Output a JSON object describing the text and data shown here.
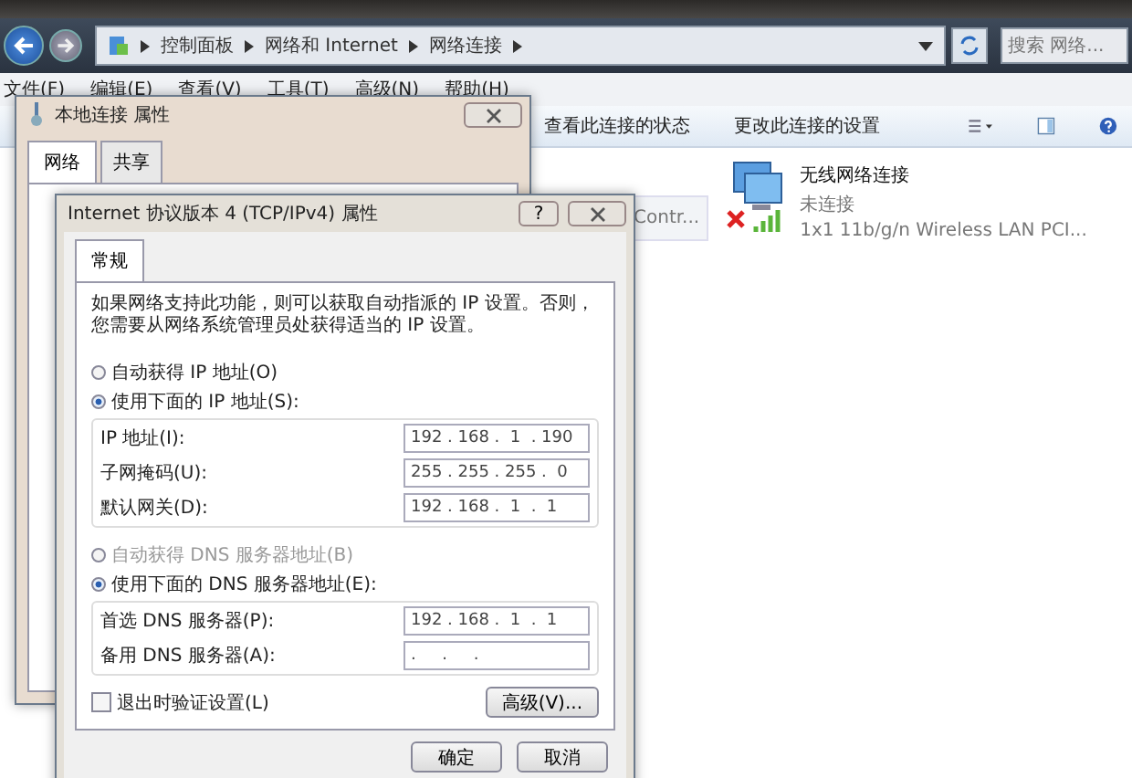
{
  "explorer": {
    "breadcrumb": [
      "控制面板",
      "网络和 Internet",
      "网络连接"
    ],
    "search": {
      "placeholder": "搜索 网络..."
    },
    "menu": [
      "文件(F)",
      "编辑(E)",
      "查看(V)",
      "工具(T)",
      "高级(N)",
      "帮助(H)"
    ],
    "toolbar": [
      "查看此连接的状态",
      "更改此连接的设置"
    ],
    "connections": [
      {
        "kind": "partial",
        "description": "Contr..."
      },
      {
        "kind": "wireless",
        "name": "无线网络连接",
        "status": "未连接",
        "description": "1x1 11b/g/n Wireless LAN PCI...",
        "connected": false
      }
    ]
  },
  "back_dialog": {
    "title": "本地连接 属性",
    "tabs": [
      {
        "label": "网络",
        "selected": true
      },
      {
        "label": "共享",
        "selected": false
      }
    ]
  },
  "front_dialog": {
    "title": "Internet 协议版本 4 (TCP/IPv4) 属性",
    "help_button": "?",
    "tabs": [
      {
        "label": "常规",
        "selected": true
      }
    ],
    "description": "如果网络支持此功能，则可以获取自动指派的 IP 设置。否则，您需要从网络系统管理员处获得适当的 IP 设置。",
    "ip_options": [
      {
        "label": "自动获得 IP 地址(O)",
        "selected": false,
        "disabled": false
      },
      {
        "label": "使用下面的 IP 地址(S):",
        "selected": true,
        "disabled": false
      }
    ],
    "ip_fields": [
      {
        "label": "IP 地址(I):",
        "value": "192 . 168 .  1  . 190"
      },
      {
        "label": "子网掩码(U):",
        "value": "255 . 255 . 255 .  0"
      },
      {
        "label": "默认网关(D):",
        "value": "192 . 168 .  1  .  1"
      }
    ],
    "dns_options": [
      {
        "label": "自动获得 DNS 服务器地址(B)",
        "selected": false,
        "disabled": true
      },
      {
        "label": "使用下面的 DNS 服务器地址(E):",
        "selected": true,
        "disabled": false
      }
    ],
    "dns_fields": [
      {
        "label": "首选 DNS 服务器(P):",
        "value": "192 . 168 .  1  .  1"
      },
      {
        "label": "备用 DNS 服务器(A):",
        "value": ".     .     ."
      }
    ],
    "verify_on_exit": {
      "label": "退出时验证设置(L)",
      "checked": false
    },
    "advanced_button": "高级(V)...",
    "buttons": [
      "确定",
      "取消"
    ]
  }
}
